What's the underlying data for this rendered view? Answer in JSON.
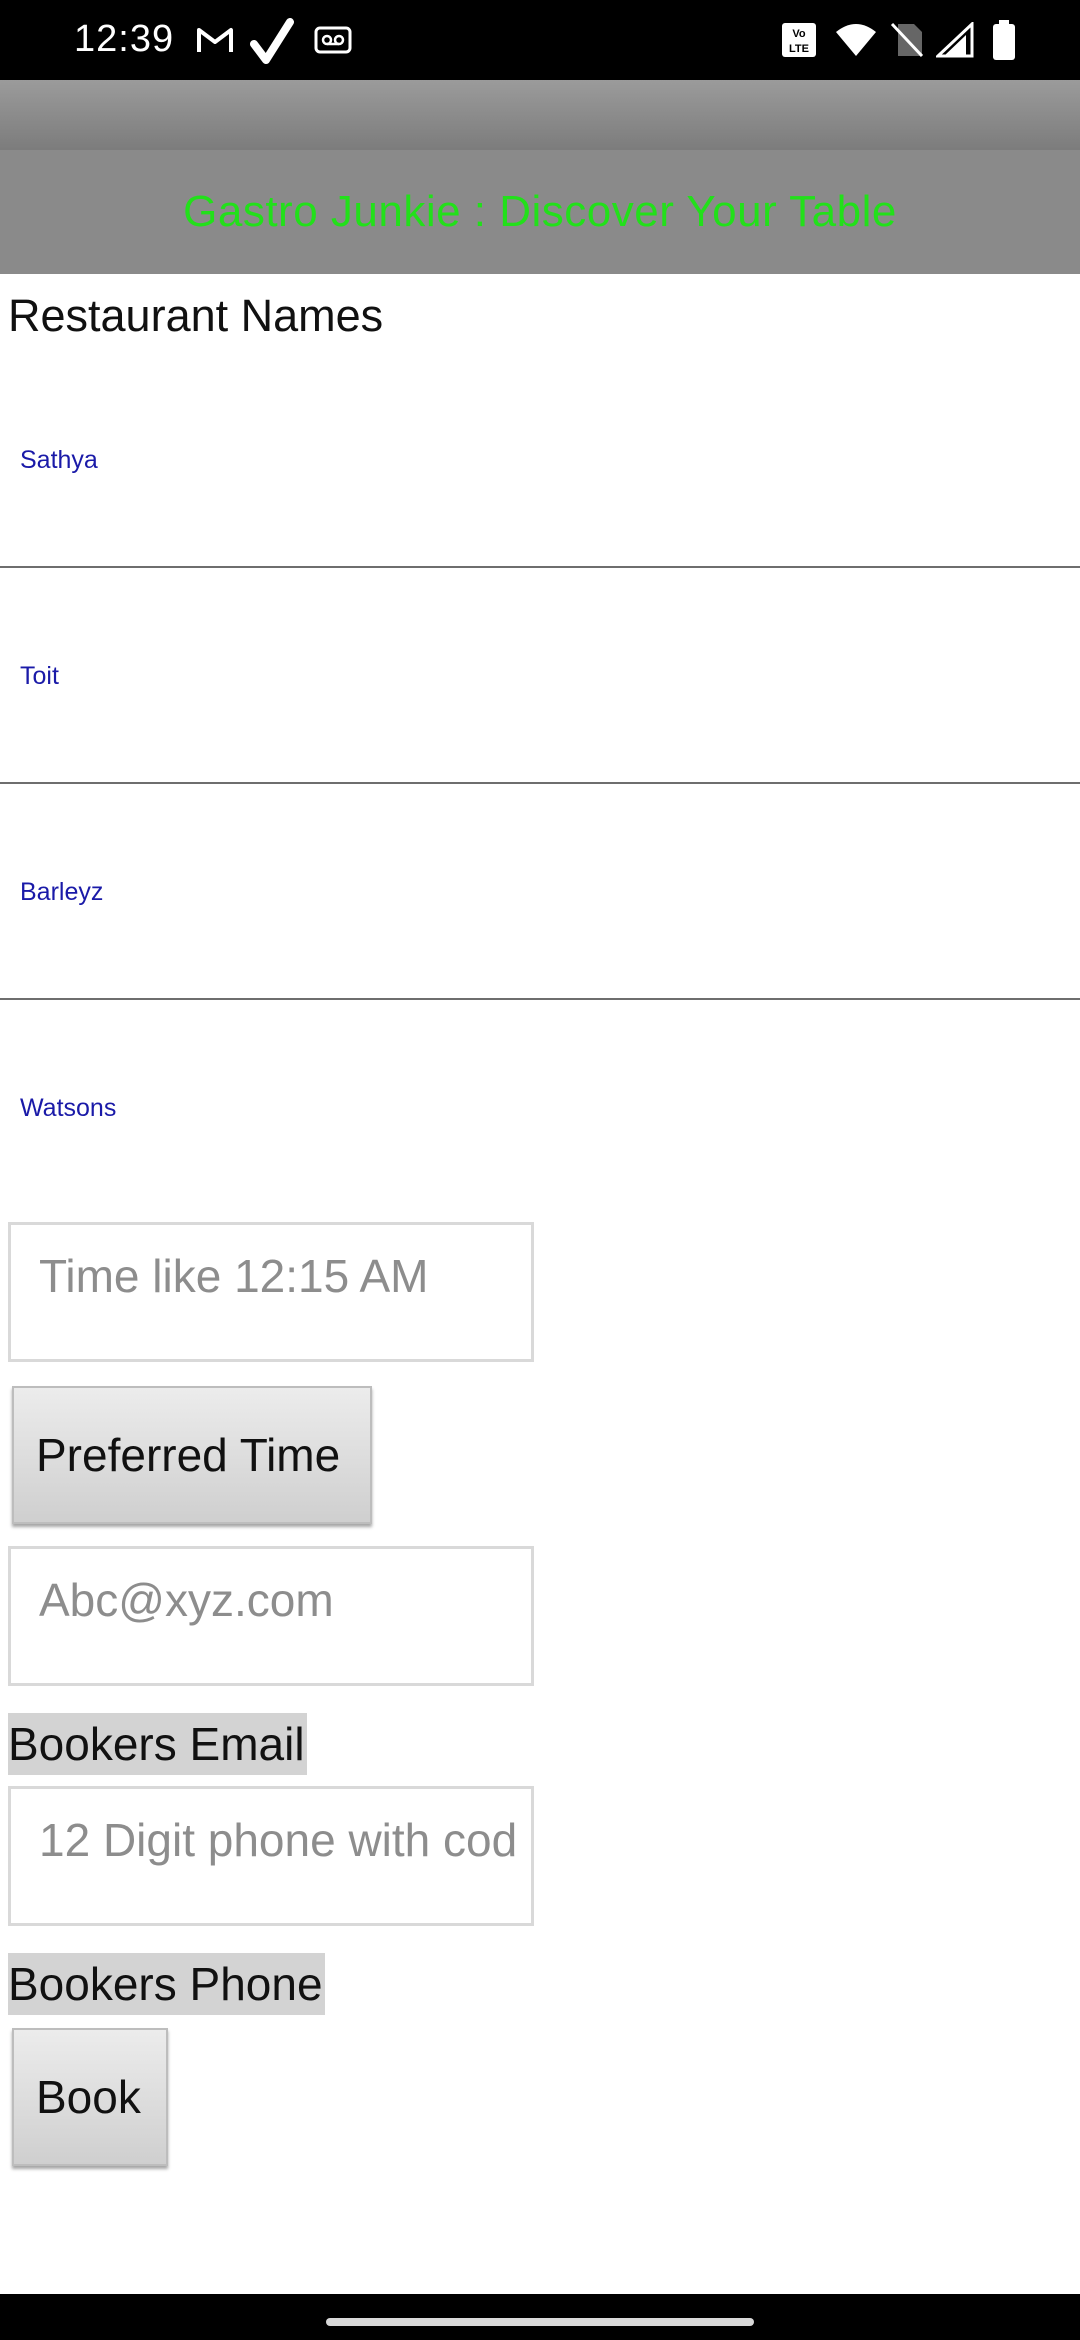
{
  "status_bar": {
    "time": "12:39",
    "left_icons": [
      "gmail-icon",
      "check-icon",
      "voicemail-icon"
    ],
    "right_icons": [
      "volte-icon",
      "wifi-icon",
      "no-sim-icon",
      "signal-icon",
      "battery-icon"
    ]
  },
  "app": {
    "title": "Gastro Junkie : Discover Your Table",
    "title_color": "#22e01a"
  },
  "restaurants": {
    "heading": "Restaurant Names",
    "items": [
      "Sathya",
      "Toit",
      "Barleyz",
      "Watsons"
    ]
  },
  "form": {
    "time_input": {
      "placeholder": "Time like 12:15 AM"
    },
    "preferred_time_button": "Preferred Time",
    "email_input": {
      "placeholder": "Abc@xyz.com"
    },
    "email_label": "Bookers Email",
    "phone_input": {
      "placeholder": "12 Digit phone with cod"
    },
    "phone_label": "Bookers Phone",
    "book_button": "Book"
  }
}
